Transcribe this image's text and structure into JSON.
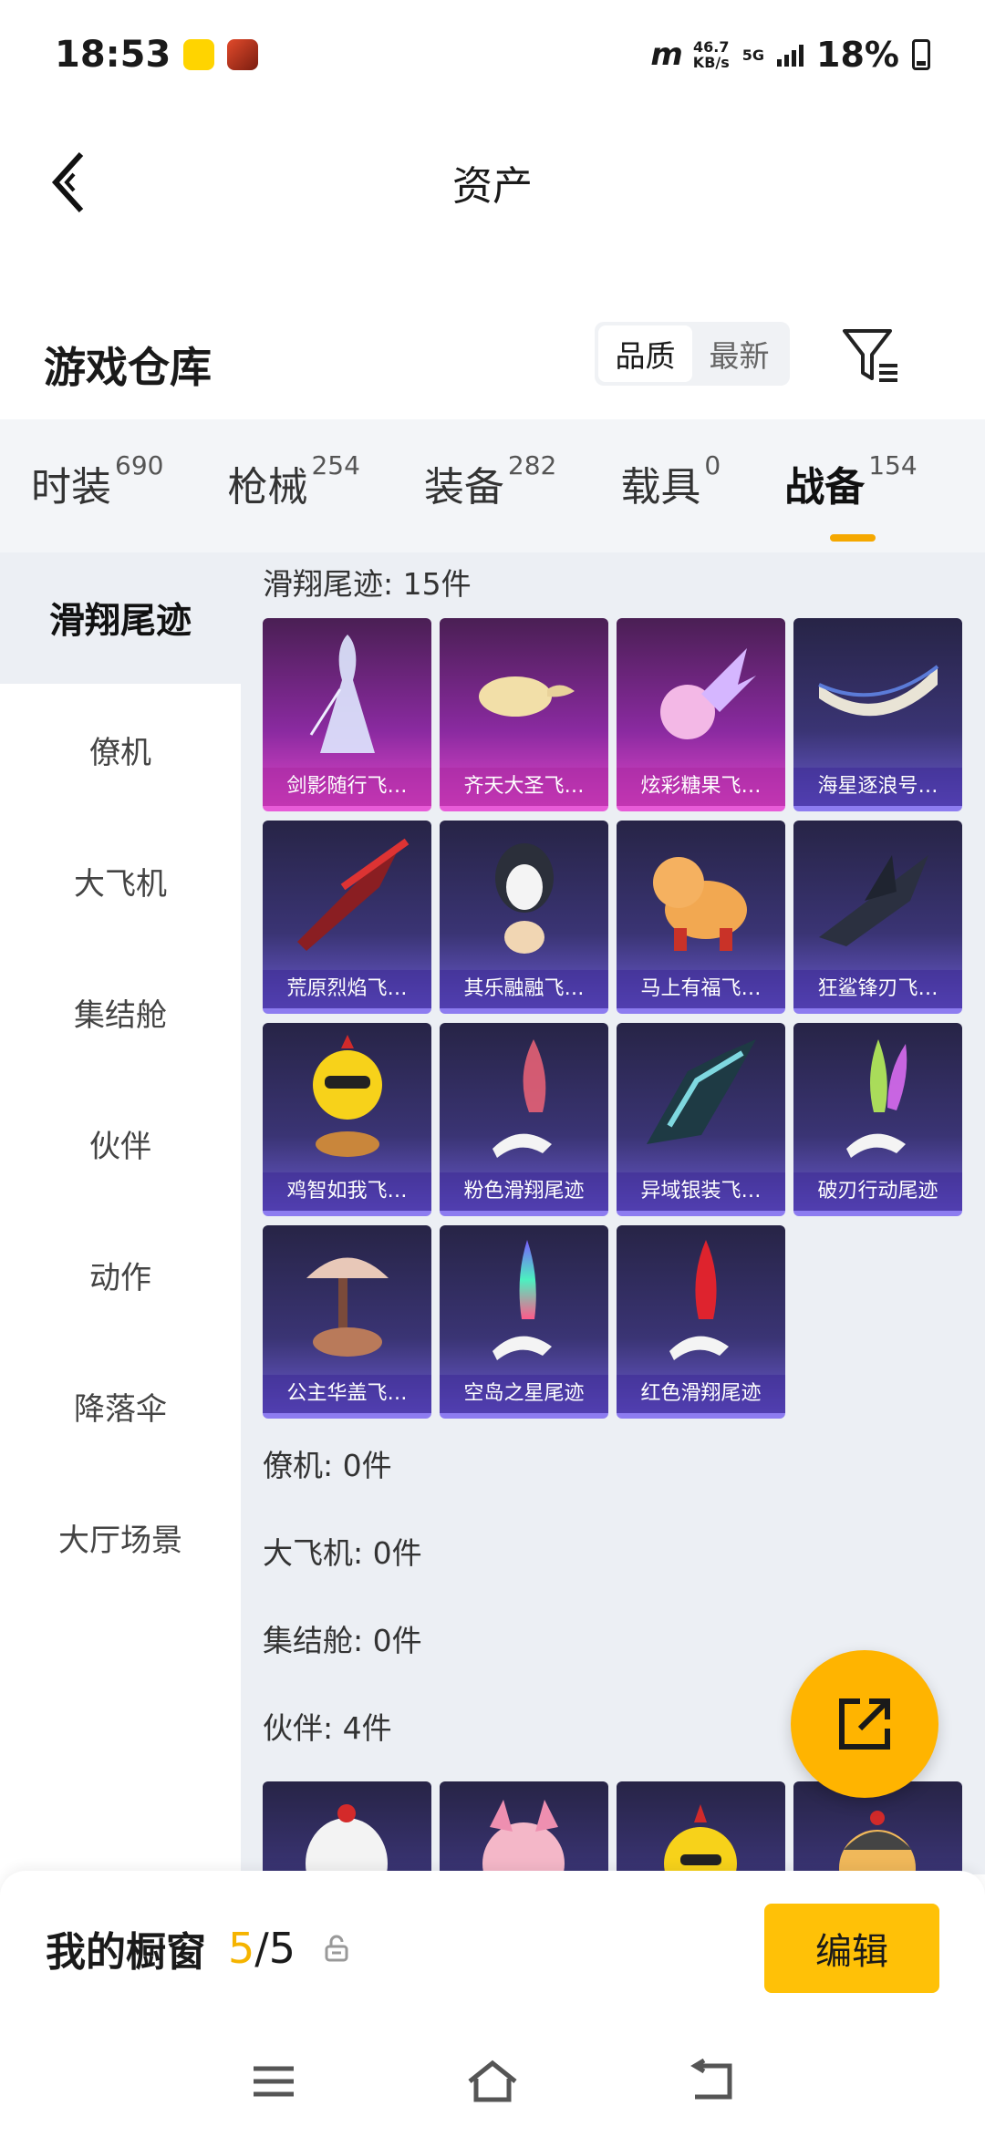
{
  "status_bar": {
    "time": "18:53",
    "net_speed_value": "46.7",
    "net_speed_unit": "KB/s",
    "network": "5G",
    "battery": "18%",
    "brand": "m"
  },
  "header": {
    "title": "资产"
  },
  "warehouse": {
    "title": "游戏仓库",
    "sort_quality": "品质",
    "sort_newest": "最新"
  },
  "tabs": [
    {
      "label": "时装",
      "count": "690"
    },
    {
      "label": "枪械",
      "count": "254"
    },
    {
      "label": "装备",
      "count": "282"
    },
    {
      "label": "载具",
      "count": "0"
    },
    {
      "label": "战备",
      "count": "154"
    }
  ],
  "sidebar": {
    "items": [
      "滑翔尾迹",
      "僚机",
      "大飞机",
      "集结舱",
      "伙伴",
      "动作",
      "降落伞",
      "大厅场景"
    ]
  },
  "sections": {
    "glide_trail": {
      "title": "滑翔尾迹: 15件",
      "items": [
        "剑影随行飞…",
        "齐天大圣飞…",
        "炫彩糖果飞…",
        "海星逐浪号…",
        "荒原烈焰飞…",
        "其乐融融飞…",
        "马上有福飞…",
        "狂鲨锋刃飞…",
        "鸡智如我飞…",
        "粉色滑翔尾迹",
        "异域银装飞…",
        "破刃行动尾迹",
        "公主华盖飞…",
        "空岛之星尾迹",
        "红色滑翔尾迹"
      ]
    },
    "wingman": {
      "title": "僚机: 0件"
    },
    "big_plane": {
      "title": "大飞机: 0件"
    },
    "assembly_pod": {
      "title": "集结舱: 0件"
    },
    "partner": {
      "title": "伙伴: 4件"
    }
  },
  "showcase": {
    "title": "我的橱窗",
    "current": "5",
    "separator_total": "/5",
    "edit_label": "编辑"
  },
  "colors": {
    "accent": "#ffc107",
    "tab_underline": "#f5a800",
    "rare_card": "#e046c8",
    "normal_card": "#6a5ad0"
  }
}
